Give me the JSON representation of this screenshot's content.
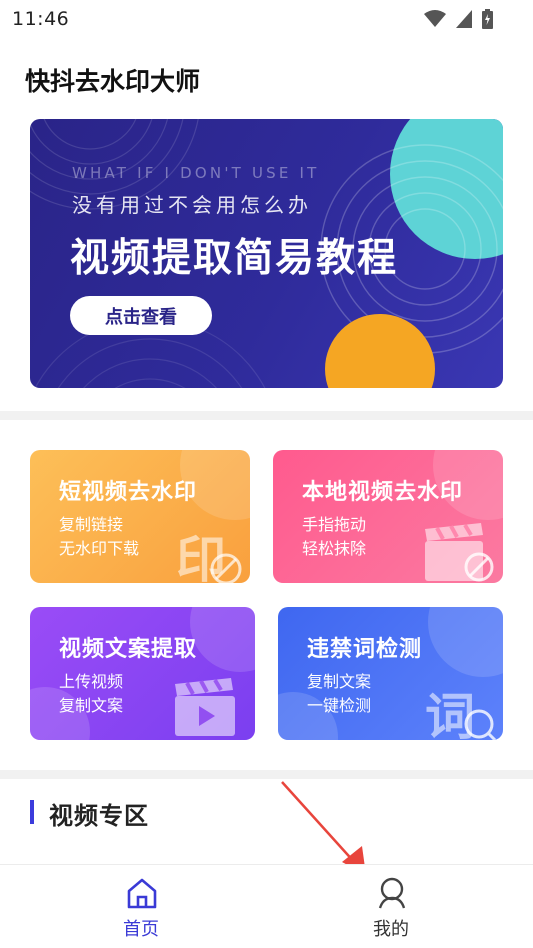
{
  "status_bar": {
    "time": "11:46",
    "icons": [
      "wifi-icon",
      "cellular-icon",
      "battery-charging-icon"
    ]
  },
  "app": {
    "title": "快抖去水印大师"
  },
  "banner": {
    "subtitle_en": "WHAT IF I DON'T USE IT",
    "subtitle_cn": "没有用过不会用怎么办",
    "title": "视频提取简易教程",
    "button_label": "点击查看",
    "colors": {
      "background": "#2a2488",
      "accent_teal": "#5ed3d6",
      "accent_orange": "#f5a623"
    }
  },
  "features": [
    {
      "title": "短视频去水印",
      "line1": "复制链接",
      "line2": "无水印下载",
      "icon": "stamp-icon",
      "color": "#f9a03e"
    },
    {
      "title": "本地视频去水印",
      "line1": "手指拖动",
      "line2": "轻松抹除",
      "icon": "clapperboard-icon",
      "color": "#ff5a8e"
    },
    {
      "title": "视频文案提取",
      "line1": "上传视频",
      "line2": "复制文案",
      "icon": "clapperboard-play-icon",
      "color": "#8a45f3"
    },
    {
      "title": "违禁词检测",
      "line1": "复制文案",
      "line2": "一键检测",
      "icon": "word-check-icon",
      "color": "#4a70f4"
    }
  ],
  "section": {
    "title": "视频专区"
  },
  "bottom_nav": {
    "items": [
      {
        "label": "首页",
        "icon": "home-icon",
        "active": true
      },
      {
        "label": "我的",
        "icon": "profile-icon",
        "active": false
      }
    ],
    "active_color": "#3a3ad6"
  }
}
